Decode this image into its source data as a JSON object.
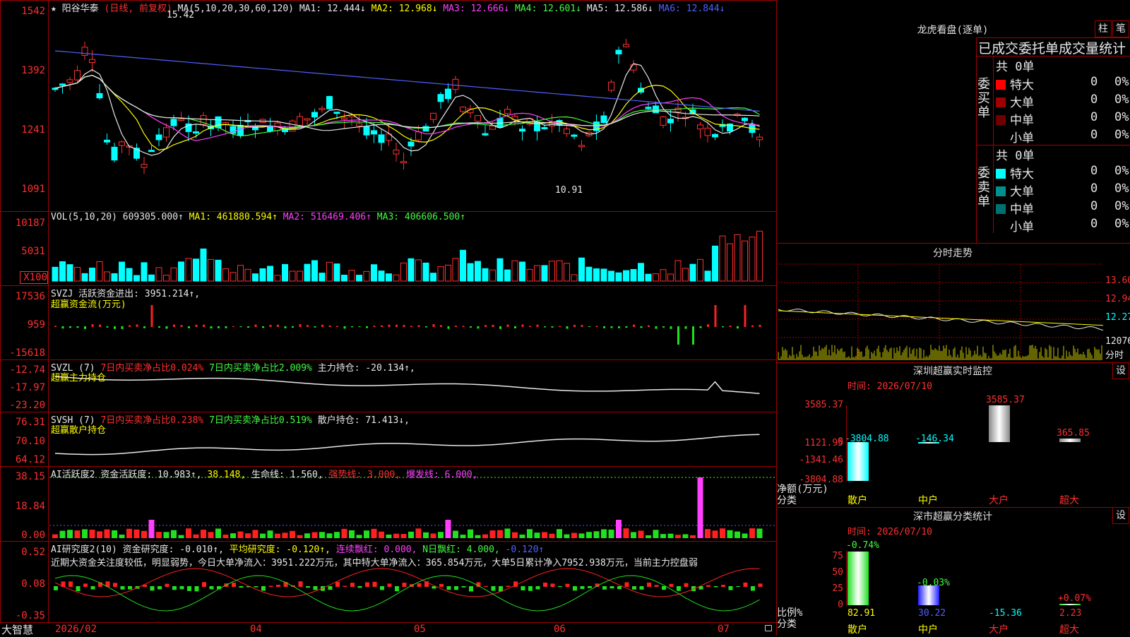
{
  "stock": {
    "star": "★",
    "name": "阳谷华泰",
    "mode": "(日线, 前复权)"
  },
  "main_chart": {
    "y_ticks": [
      "1542",
      "1392",
      "1241",
      "1091"
    ],
    "ma_header": "MA(5,10,20,30,60,120)",
    "ma": [
      {
        "label": "MA1: 12.444↓",
        "color": "#e8e8e8"
      },
      {
        "label": "MA2: 12.968↓",
        "color": "#ffff00"
      },
      {
        "label": "MA3: 12.666↓",
        "color": "#ff40ff"
      },
      {
        "label": "MA4: 12.601↓",
        "color": "#40ff40"
      },
      {
        "label": "MA5: 12.586↓",
        "color": "#e8e8e8"
      },
      {
        "label": "MA6: 12.844↓",
        "color": "#5060ff"
      }
    ],
    "high_note": "15.42",
    "low_note": "10.91"
  },
  "vol_panel": {
    "header": "VOL(5,10,20)",
    "vol": "609305.000↑",
    "ma1": "MA1: 461880.594↑",
    "ma2": "MA2: 516469.406↑",
    "ma3": "MA3: 406606.500↑",
    "y_ticks": [
      "10187",
      "5031",
      "X100"
    ]
  },
  "svzj_panel": {
    "header": "SVZJ",
    "text": "活跃资金进出: 3951.214↑,",
    "sub": "超赢资金流(万元)",
    "y_ticks": [
      "17536",
      "959",
      "-15618"
    ]
  },
  "svzl_panel": {
    "header": "SVZL (7)",
    "a": "7日内买卖净占比0.024%",
    "b": "7日内买卖净占比2.009%",
    "c": "主力持仓: -20.134↑,",
    "sub": "超赢主力持仓",
    "y_ticks": [
      "-12.74",
      "-17.97",
      "-23.20"
    ]
  },
  "svsh_panel": {
    "header": "SVSH (7)",
    "a": "7日内买卖净占比0.238%",
    "b": "7日内买卖净占比0.519%",
    "c": "散户持仓: 71.413↓,",
    "sub": "超赢散户持仓",
    "y_ticks": [
      "76.31",
      "70.10",
      "64.12"
    ]
  },
  "ai_active": {
    "header": "AI活跃度2",
    "a": "资金活跃度: 10.983↑,",
    "b": "38.148,",
    "c": "生命线: 1.560,",
    "d": "强势线: 3.000,",
    "e": "爆发线: 6.000,",
    "y_ticks": [
      "38.15",
      "18.84",
      "0.00"
    ]
  },
  "ai_research": {
    "header": "AI研究度2(10)",
    "a": "资金研究度: -0.010↑,",
    "b": "平均研究度: -0.120↑,",
    "c": "连续飘红: 0.000,",
    "d": "N日飘红: 4.000,",
    "e": "-0.120↑",
    "comment": "近期大资金关注度较低，明显弱势，今日大单净流入：3951.222万元，其中特大单净流入：365.854万元，大单5日累计净入7952.938万元，当前主力控盘弱",
    "y_ticks": [
      "0.52",
      "0.08",
      "-0.35"
    ]
  },
  "x_axis": {
    "brand": "大智慧",
    "labels": [
      "2026/02",
      "04",
      "05",
      "06",
      "07"
    ]
  },
  "dragon": {
    "title": "龙虎看盘(逐单)",
    "btn1": "柱",
    "btn2": "笔",
    "header": "已成交委托单成交量统计",
    "buy_label": "委买单",
    "sell_label": "委卖单",
    "buy_total": "共 0单",
    "sell_total": "共 0单",
    "buy_rows": [
      {
        "name": "特大",
        "count": "0",
        "pct": "0%",
        "color": "#ff0000"
      },
      {
        "name": "大单",
        "count": "0",
        "pct": "0%",
        "color": "#a00000"
      },
      {
        "name": "中单",
        "count": "0",
        "pct": "0%",
        "color": "#700000"
      },
      {
        "name": "小单",
        "count": "0",
        "pct": "0%",
        "color": ""
      }
    ],
    "sell_rows": [
      {
        "name": "特大",
        "count": "0",
        "pct": "0%",
        "color": "#00ffff"
      },
      {
        "name": "大单",
        "count": "0",
        "pct": "0%",
        "color": "#009090"
      },
      {
        "name": "中单",
        "count": "0",
        "pct": "0%",
        "color": "#007070"
      },
      {
        "name": "小单",
        "count": "0",
        "pct": "0%",
        "color": ""
      }
    ]
  },
  "intraday": {
    "title": "分时走势",
    "y_ticks": [
      "13.60",
      "12.94",
      "12.27",
      "12076"
    ],
    "vol_label": "分时"
  },
  "sz_monitor": {
    "title": "深圳超赢实时监控",
    "btn": "设",
    "time": "时间: 2026/07/10",
    "y_ticks": [
      "3585.37",
      "1121.95",
      "0",
      "-1341.46",
      "-3804.88"
    ],
    "values": [
      "-3804.88",
      "-146.34",
      "3585.37",
      "365.85"
    ],
    "unit": "净额(万元)",
    "cat_label": "分类",
    "cats": [
      "散户",
      "中户",
      "大户",
      "超大"
    ]
  },
  "sz_class": {
    "title": "深市超赢分类统计",
    "btn": "设",
    "time": "时间: 2026/07/10",
    "y_ticks": [
      "75",
      "50",
      "25",
      "0"
    ],
    "top_values": [
      "-0.74%",
      "-0.03%",
      "+0.07%"
    ],
    "bottom_values": [
      "82.91",
      "30.22",
      "-15.36",
      "2.23"
    ],
    "unit": "比例%",
    "cat_label": "分类",
    "cats": [
      "散户",
      "中户",
      "大户",
      "超大"
    ]
  }
}
